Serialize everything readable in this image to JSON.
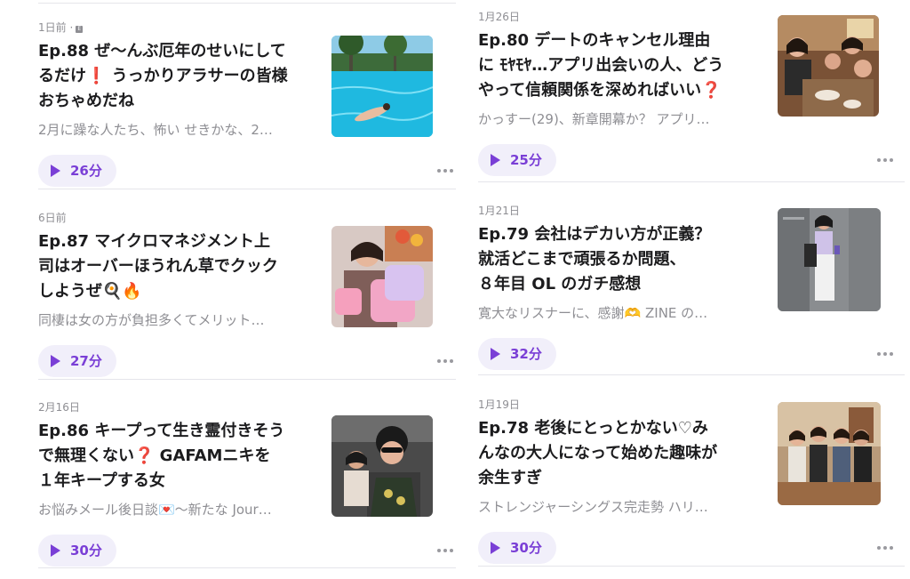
{
  "episodes_left": [
    {
      "date": "1日前 ·",
      "badge": "E",
      "title_lines": [
        "Ep.88 ぜ〜んぶ厄年のせいにして",
        "るだけ❗️ うっかりアラサーの皆様",
        "おちゃめだね"
      ],
      "description": "2月に躁な人たち、怖い せきかな、2…",
      "duration": "26分",
      "image": "pool-swimmer-image"
    },
    {
      "date": "6日前",
      "title_lines": [
        "Ep.87 マイクロマネジメント上",
        "司はオーバーほうれん草でクック",
        "しようぜ🍳🔥"
      ],
      "description": "同棲は女の方が負担多くてメリット…",
      "duration": "27分",
      "image": "woman-with-pink-bags-image"
    },
    {
      "date": "2月16日",
      "title_lines": [
        "Ep.86 キープって生き霊付きそう",
        "で無理くない❓ GAFAMニキを",
        "１年キープする女"
      ],
      "description": "お悩みメール後日談💌〜新たな Jour…",
      "duration": "30分",
      "image": "car-selfie-image"
    }
  ],
  "episodes_right": [
    {
      "date": "1月26日",
      "title_lines": [
        "Ep.80 デートのキャンセル理由",
        "に ﾓﾔﾓﾔ…アプリ出会いの人、どう",
        "やって信頼関係を深めればいい❓"
      ],
      "description": "かっすー(29)、新章開幕か？ アプリ…",
      "duration": "25分",
      "image": "restaurant-group-image"
    },
    {
      "date": "1月21日",
      "title_lines": [
        "Ep.79 会社はデカい方が正義？",
        "就活どこまで頑張るか問題、",
        "８年目 OL のガチ感想"
      ],
      "description": "寛大なリスナーに、感謝🫶 ZINE の…",
      "duration": "32分",
      "image": "elevator-mirror-selfie-image"
    },
    {
      "date": "1月19日",
      "title_lines": [
        "Ep.78 老後にとっとかない♡み",
        "んなの大人になって始めた趣味が",
        "余生すぎ"
      ],
      "description": "ストレンジャーシングス完走勢 ハリ…",
      "duration": "30分",
      "image": "friends-toast-image"
    }
  ],
  "colors": {
    "accent": "#7a3fd6",
    "play_bg": "#f1effa",
    "meta": "#8e8e93",
    "separator": "#e5e5ea"
  },
  "icons": {
    "play": "play-icon",
    "more": "more-dots-icon"
  }
}
